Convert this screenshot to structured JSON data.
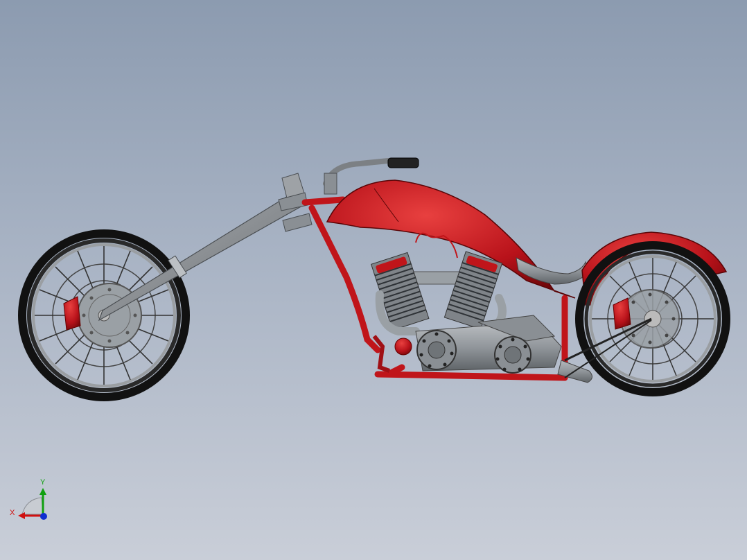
{
  "viewport": {
    "background_top": "#8c9bb0",
    "background_bottom": "#c9ced8",
    "model": "motorcycle-chopper"
  },
  "colors": {
    "frame_red": "#c0151a",
    "metal_gray": "#8a8f94",
    "tire_black": "#111111",
    "rim_silver": "#b8bcc0"
  },
  "triad": {
    "x_label": "X",
    "y_label": "Y",
    "x_color": "#d01010",
    "y_color": "#10a010",
    "z_color": "#1030d0"
  }
}
